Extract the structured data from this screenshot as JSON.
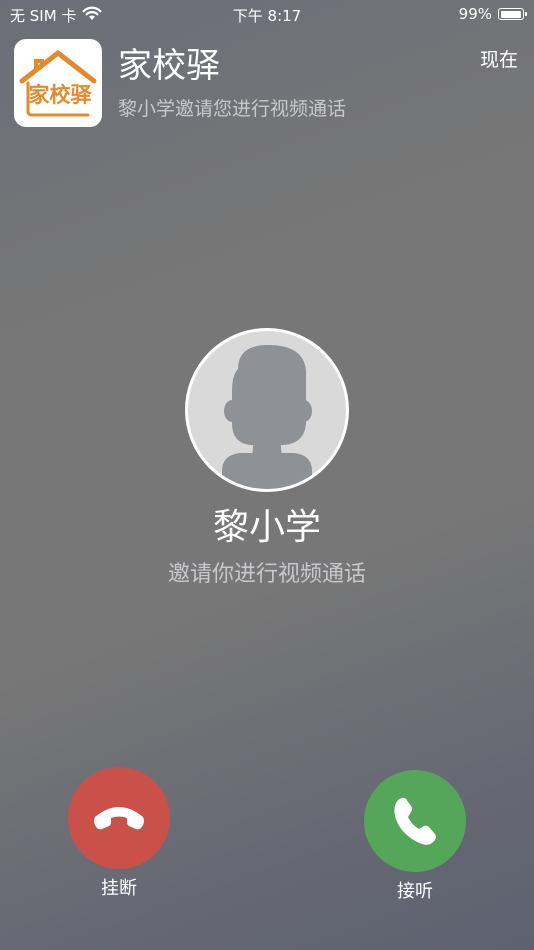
{
  "status_bar": {
    "carrier": "无 SIM 卡",
    "time": "下午 8:17",
    "battery": "99%",
    "battery_level": 0.99
  },
  "notification": {
    "app_icon_text": "家校驿",
    "app_name": "家校驿",
    "message": "黎小学邀请您进行视频通话",
    "time": "现在",
    "brand_color": "#e38b2c"
  },
  "caller": {
    "name": "黎小学",
    "status": "邀请你进行视频通话"
  },
  "actions": {
    "hangup_label": "挂断",
    "answer_label": "接听",
    "hangup_color": "#c9514a",
    "answer_color": "#55a65a"
  }
}
